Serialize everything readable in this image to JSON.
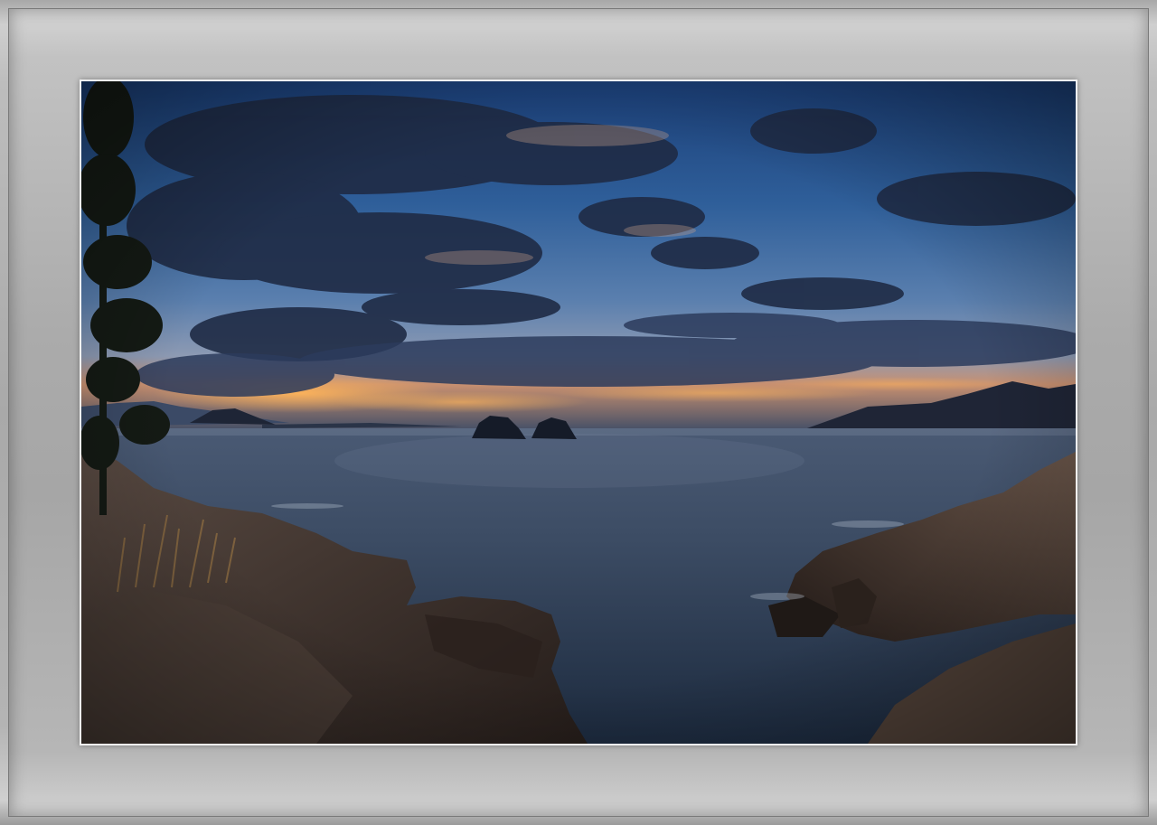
{
  "photo": {
    "subject": "twilight-seascape",
    "colors": {
      "sky_top": "#1d4f8f",
      "sky_mid": "#3a6ea8",
      "sky_horizon": "#7a8fb0",
      "glow": "#f2a14a",
      "sea": "#3c4e66",
      "rocks": "#3a302c",
      "frame": "#b0b0b0"
    }
  }
}
